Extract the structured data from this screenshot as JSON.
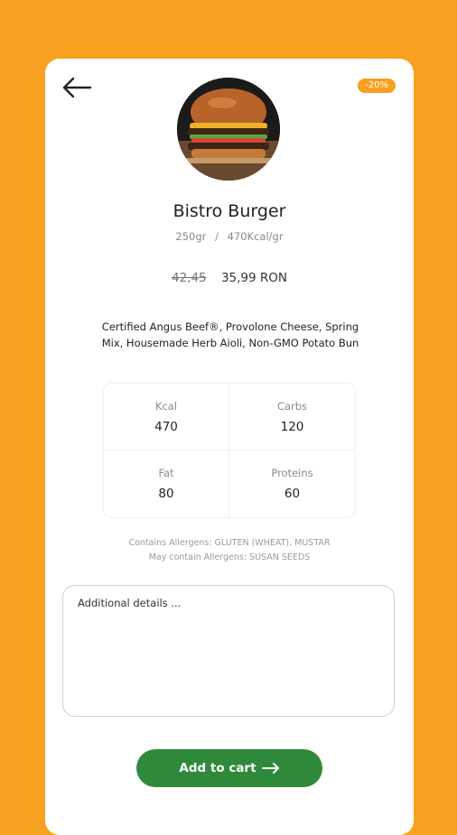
{
  "product": {
    "discount_badge": "-20%",
    "title": "Bistro Burger",
    "weight": "250gr",
    "separator": "/",
    "calories_per_gram": "470Kcal/gr",
    "old_price": "42,45",
    "new_price": "35,99 RON",
    "description": "Certified Angus Beef®, Provolone Cheese, Spring Mix, Housemade Herb Aioli, Non-GMO Potato Bun"
  },
  "nutrition": [
    {
      "label": "Kcal",
      "value": "470"
    },
    {
      "label": "Carbs",
      "value": "120"
    },
    {
      "label": "Fat",
      "value": "80"
    },
    {
      "label": "Proteins",
      "value": "60"
    }
  ],
  "allergens": {
    "contains": "Contains Allergens: GLUTEN (WHEAT), MUSTAR",
    "may_contain": "May contain Allergens: SUSAN SEEDS"
  },
  "details": {
    "placeholder": "Additional details ...",
    "value": ""
  },
  "cart_button": {
    "label": "Add to cart"
  },
  "icons": {
    "back": "arrow-left-icon",
    "cart_arrow": "arrow-right-icon"
  },
  "colors": {
    "background": "#f8a121",
    "badge": "#f8a121",
    "cart_button": "#2e8a3a"
  }
}
